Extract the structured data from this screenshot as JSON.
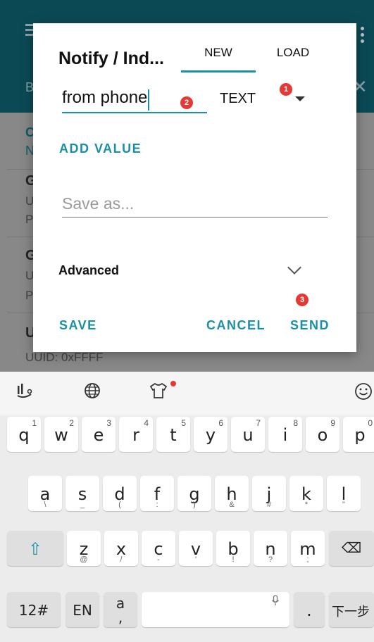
{
  "background": {
    "tab_letter": "B",
    "items": [
      {
        "line1": "C",
        "line2": "N"
      },
      {
        "title": "G",
        "sub1": "U",
        "sub2": "P"
      },
      {
        "title": "G",
        "sub1": "U",
        "sub2": "P"
      },
      {
        "title": "U",
        "sub1": "UUID: 0xFFFF"
      }
    ]
  },
  "dialog": {
    "title": "Notify / Ind...",
    "tabs": [
      {
        "label": "NEW"
      },
      {
        "label": "LOAD"
      }
    ],
    "value_field": {
      "value": "from phone"
    },
    "type_select": {
      "value": "TEXT"
    },
    "badges": [
      "1",
      "2",
      "3"
    ],
    "add_value_label": "ADD VALUE",
    "save_as": {
      "placeholder": "Save as..."
    },
    "advanced_label": "Advanced",
    "actions": {
      "save": "SAVE",
      "cancel": "CANCEL",
      "send": "SEND"
    }
  },
  "keyboard": {
    "toolbar": {
      "left_icon": "handwriting-icon",
      "globe_icon": "globe-icon",
      "theme_icon": "tshirt-icon",
      "emoji_icon": "smiley-icon"
    },
    "row1": [
      {
        "k": "q",
        "n": "1"
      },
      {
        "k": "w",
        "n": "2"
      },
      {
        "k": "e",
        "n": "3"
      },
      {
        "k": "r",
        "n": "4"
      },
      {
        "k": "t",
        "n": "5"
      },
      {
        "k": "y",
        "n": "6"
      },
      {
        "k": "u",
        "n": "7"
      },
      {
        "k": "i",
        "n": "8"
      },
      {
        "k": "o",
        "n": "9"
      },
      {
        "k": "p",
        "n": "0"
      }
    ],
    "row2": [
      {
        "k": "a",
        "s": "\\"
      },
      {
        "k": "s",
        "s": "_"
      },
      {
        "k": "d",
        "s": "("
      },
      {
        "k": "f",
        "s": ":"
      },
      {
        "k": "g",
        "s": ")"
      },
      {
        "k": "h",
        "s": "&"
      },
      {
        "k": "j",
        "s": "#"
      },
      {
        "k": "k",
        "s": "*"
      },
      {
        "k": "l",
        "s": "\""
      }
    ],
    "row3": [
      {
        "k": "z",
        "s": "@"
      },
      {
        "k": "x",
        "s": "/"
      },
      {
        "k": "c",
        "s": "-"
      },
      {
        "k": "v",
        "s": "'"
      },
      {
        "k": "b",
        "s": "!"
      },
      {
        "k": "n",
        "s": "?"
      },
      {
        "k": "m",
        "s": ";"
      }
    ],
    "shift": "⇧",
    "backspace": "⌫",
    "bottom": {
      "num": "12#",
      "lang": "EN",
      "punct_top": "a",
      "punct_bottom": ",",
      "mic": "🎙",
      "dot": ".",
      "next": "下一步"
    }
  }
}
